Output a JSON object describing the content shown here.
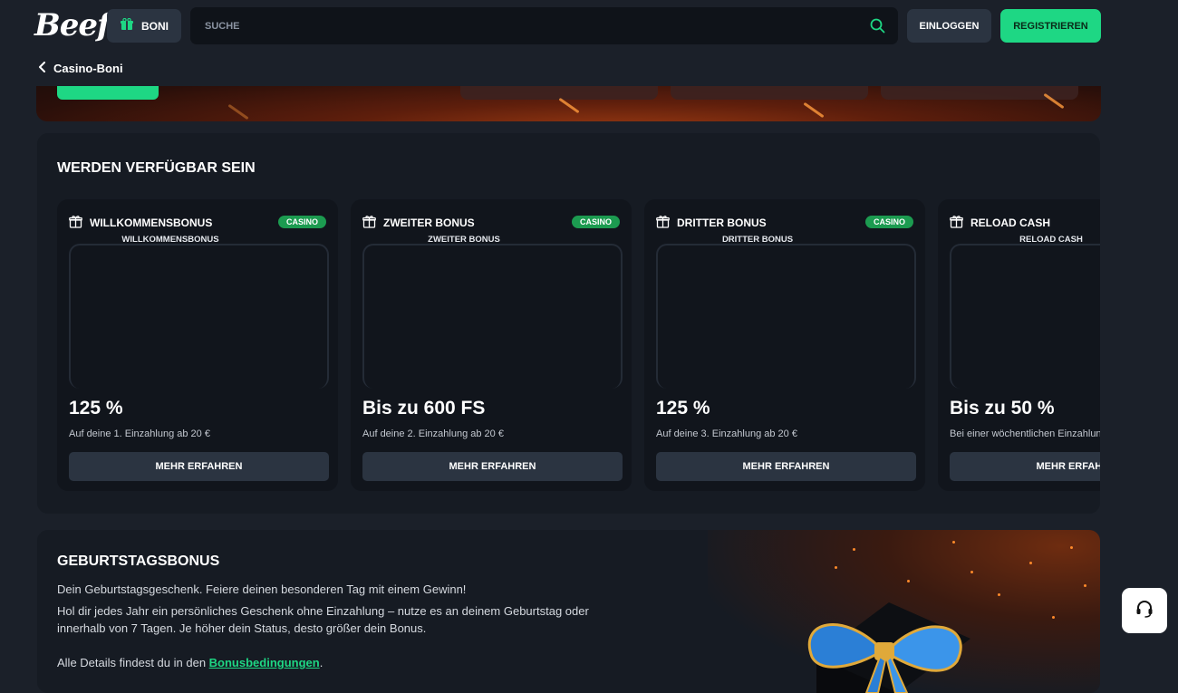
{
  "header": {
    "logo": "Beef",
    "boni_label": "BONI",
    "search_placeholder": "SUCHE",
    "login_label": "EINLOGGEN",
    "register_label": "REGISTRIEREN"
  },
  "subheader": {
    "back_label": "Casino-Boni"
  },
  "section": {
    "title": "WERDEN VERFÜGBAR SEIN",
    "cards": [
      {
        "title": "WILLKOMMENSBONUS",
        "badge": "CASINO",
        "subtitle": "WILLKOMMENSBONUS",
        "amount": "125 %",
        "description": "Auf deine 1. Einzahlung ab 20 €",
        "button": "MEHR ERFAHREN"
      },
      {
        "title": "ZWEITER BONUS",
        "badge": "CASINO",
        "subtitle": "ZWEITER BONUS",
        "amount": "Bis zu 600 FS",
        "description": "Auf deine 2. Einzahlung ab 20 €",
        "button": "MEHR ERFAHREN"
      },
      {
        "title": "DRITTER BONUS",
        "badge": "CASINO",
        "subtitle": "DRITTER BONUS",
        "amount": "125 %",
        "description": "Auf deine 3. Einzahlung ab 20 €",
        "button": "MEHR ERFAHREN"
      },
      {
        "title": "RELOAD CASH",
        "badge": "",
        "subtitle": "RELOAD CASH",
        "amount": "Bis zu 50 %",
        "description": "Bei einer wöchentlichen Einzahlung",
        "button": "MEHR ERFAHREN"
      }
    ]
  },
  "birthday": {
    "title": "GEBURTSTAGSBONUS",
    "line1": "Dein Geburtstagsgeschenk. Feiere deinen besonderen Tag mit einem Gewinn!",
    "line2": "Hol dir jedes Jahr ein persönliches Geschenk ohne Einzahlung – nutze es an deinem Geburtstag oder innerhalb von 7 Tagen. Je höher dein Status, desto größer dein Bonus.",
    "details_prefix": "Alle Details findest du in den ",
    "details_link": "Bonusbedingungen",
    "details_suffix": "."
  },
  "colors": {
    "accent": "#1ed784",
    "badge": "#1c9b50",
    "background": "#1b2029"
  },
  "icons": {
    "gift": "gift-icon",
    "search": "search-icon",
    "support": "headset-icon",
    "back": "chevron-left-icon"
  }
}
